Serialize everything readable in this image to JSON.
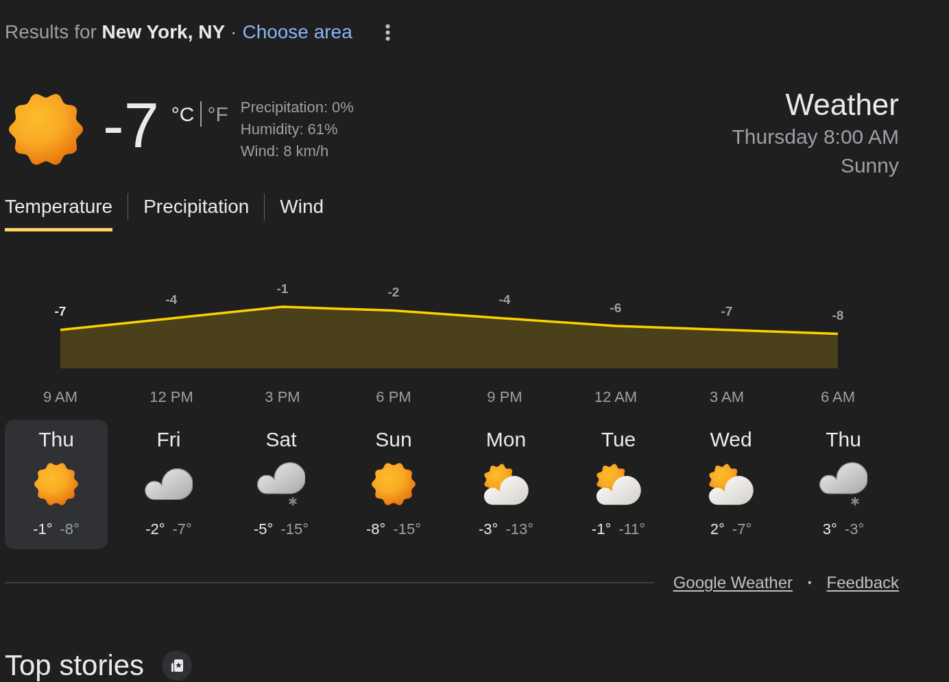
{
  "header": {
    "text": "Results for **New York, NY**",
    "separator": "·",
    "link": "Choose area"
  },
  "current": {
    "kind": "sun",
    "temperature": "-7",
    "units": [
      {
        "label": "°C",
        "selected": true
      },
      {
        "label": "°F",
        "selected": false
      }
    ],
    "details": [
      "Precipitation: 0%",
      "Humidity: 61%",
      "Wind: 8 km/h"
    ],
    "title": "Weather",
    "time": "Thursday 8:00 AM",
    "condition": "Sunny"
  },
  "tabs": [
    {
      "label": "Temperature",
      "selected": true
    },
    {
      "label": "Precipitation",
      "selected": false
    },
    {
      "label": "Wind",
      "selected": false
    }
  ],
  "hourly": {
    "chart_data": {
      "type": "area",
      "categories": [
        "9 AM",
        "12 PM",
        "3 PM",
        "6 PM",
        "9 PM",
        "12 AM",
        "3 AM",
        "6 AM"
      ],
      "values": [
        -7,
        -4,
        -1,
        -2,
        -4,
        -6,
        -7,
        -8
      ],
      "data_labels": true
    }
  },
  "days": [
    {
      "name": "Thu",
      "kind": "sun",
      "high": "-1°",
      "low": "-8°",
      "selected": true
    },
    {
      "name": "Fri",
      "kind": "cloud",
      "high": "-2°",
      "low": "-7°",
      "selected": false
    },
    {
      "name": "Sat",
      "kind": "snow",
      "high": "-5°",
      "low": "-15°",
      "selected": false
    },
    {
      "name": "Sun",
      "kind": "sun",
      "high": "-8°",
      "low": "-15°",
      "selected": false
    },
    {
      "name": "Mon",
      "kind": "partsun",
      "high": "-3°",
      "low": "-13°",
      "selected": false
    },
    {
      "name": "Tue",
      "kind": "partsun",
      "high": "-1°",
      "low": "-11°",
      "selected": false
    },
    {
      "name": "Wed",
      "kind": "partsun",
      "high": "2°",
      "low": "-7°",
      "selected": false
    },
    {
      "name": "Thu",
      "kind": "snow",
      "high": "3°",
      "low": "-3°",
      "selected": false
    }
  ],
  "footer": {
    "links": [
      "Google Weather",
      "Feedback"
    ],
    "separator": "•"
  },
  "top_stories": {
    "title": "Top stories"
  }
}
